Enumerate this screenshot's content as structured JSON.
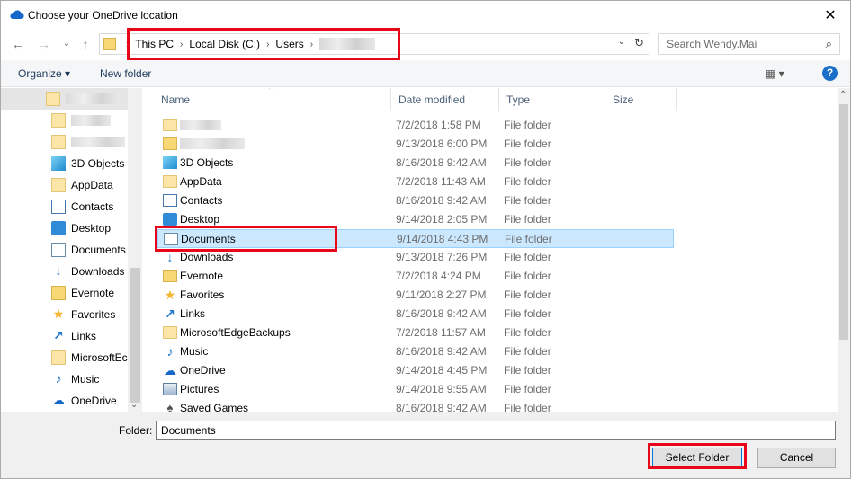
{
  "window": {
    "title": "Choose your OneDrive location",
    "close_glyph": "✕"
  },
  "nav": {
    "back": "←",
    "forward": "→",
    "recent": "⌄",
    "up": "↑"
  },
  "address": {
    "crumbs": [
      "This PC",
      "Local Disk (C:)",
      "Users"
    ],
    "dropdown": "⌄",
    "refresh": "↻"
  },
  "search": {
    "placeholder": "Search Wendy.Mai",
    "icon": "⌕"
  },
  "toolbar": {
    "organize": "Organize ▾",
    "new_folder": "New folder",
    "view": "▦ ▾",
    "help": "?"
  },
  "sidebar": {
    "items": [
      {
        "label": "3D Objects",
        "icon": "cube-icon"
      },
      {
        "label": "AppData",
        "icon": "folder-icon"
      },
      {
        "label": "Contacts",
        "icon": "contacts-icon"
      },
      {
        "label": "Desktop",
        "icon": "desktop-icon"
      },
      {
        "label": "Documents",
        "icon": "documents-icon"
      },
      {
        "label": "Downloads",
        "icon": "downloads-icon"
      },
      {
        "label": "Evernote",
        "icon": "folder-icon"
      },
      {
        "label": "Favorites",
        "icon": "star-icon"
      },
      {
        "label": "Links",
        "icon": "links-icon"
      },
      {
        "label": "MicrosoftEc",
        "icon": "folder-icon"
      },
      {
        "label": "Music",
        "icon": "music-icon"
      },
      {
        "label": "OneDrive",
        "icon": "cloud-icon"
      }
    ]
  },
  "columns": {
    "name": "Name",
    "date": "Date modified",
    "type": "Type",
    "size": "Size"
  },
  "files": [
    {
      "name": "",
      "date": "7/2/2018 1:58 PM",
      "type": "File folder",
      "icon": "folder-icon"
    },
    {
      "name": "",
      "date": "9/13/2018 6:00 PM",
      "type": "File folder",
      "icon": "folder-icon"
    },
    {
      "name": "3D Objects",
      "date": "8/16/2018 9:42 AM",
      "type": "File folder",
      "icon": "cube-icon"
    },
    {
      "name": "AppData",
      "date": "7/2/2018 11:43 AM",
      "type": "File folder",
      "icon": "folder-icon"
    },
    {
      "name": "Contacts",
      "date": "8/16/2018 9:42 AM",
      "type": "File folder",
      "icon": "contacts-icon"
    },
    {
      "name": "Desktop",
      "date": "9/14/2018 2:05 PM",
      "type": "File folder",
      "icon": "desktop-icon"
    },
    {
      "name": "Documents",
      "date": "9/14/2018 4:43 PM",
      "type": "File folder",
      "icon": "documents-icon"
    },
    {
      "name": "Downloads",
      "date": "9/13/2018 7:26 PM",
      "type": "File folder",
      "icon": "downloads-icon"
    },
    {
      "name": "Evernote",
      "date": "7/2/2018 4:24 PM",
      "type": "File folder",
      "icon": "folder-icon"
    },
    {
      "name": "Favorites",
      "date": "9/11/2018 2:27 PM",
      "type": "File folder",
      "icon": "star-icon"
    },
    {
      "name": "Links",
      "date": "8/16/2018 9:42 AM",
      "type": "File folder",
      "icon": "links-icon"
    },
    {
      "name": "MicrosoftEdgeBackups",
      "date": "7/2/2018 11:57 AM",
      "type": "File folder",
      "icon": "folder-icon"
    },
    {
      "name": "Music",
      "date": "8/16/2018 9:42 AM",
      "type": "File folder",
      "icon": "music-icon"
    },
    {
      "name": "OneDrive",
      "date": "9/14/2018 4:45 PM",
      "type": "File folder",
      "icon": "cloud-icon"
    },
    {
      "name": "Pictures",
      "date": "9/14/2018 9:55 AM",
      "type": "File folder",
      "icon": "pictures-icon"
    },
    {
      "name": "Saved Games",
      "date": "8/16/2018 9:42 AM",
      "type": "File folder",
      "icon": "games-icon"
    }
  ],
  "footer": {
    "folder_label": "Folder:",
    "folder_value": "Documents",
    "select_button": "Select Folder",
    "cancel_button": "Cancel"
  },
  "colors": {
    "highlight_box": "#e8071a",
    "selection": "#cce8ff",
    "accent": "#0078d7"
  }
}
